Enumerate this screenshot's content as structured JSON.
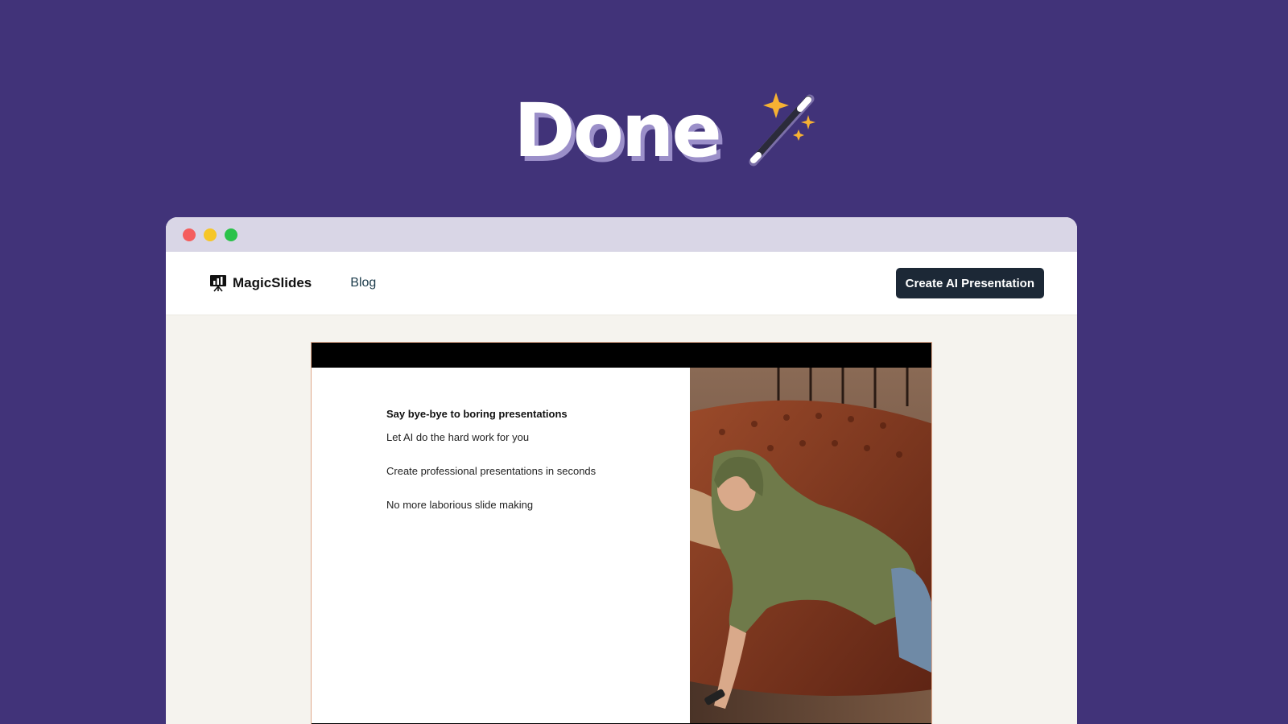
{
  "hero": {
    "title": "Done",
    "icon": "magic-wand-icon",
    "title_shadow_color": "#9b8fc9",
    "sparkle_color": "#f6b133"
  },
  "browser": {
    "controls": [
      "close",
      "minimize",
      "maximize"
    ],
    "control_colors": {
      "close": "#f45d5d",
      "minimize": "#f6c627",
      "maximize": "#2ac24a"
    }
  },
  "nav": {
    "brand_icon": "presentation-board-icon",
    "brand_name": "MagicSlides",
    "blog_label": "Blog",
    "cta_label": "Create AI Presentation"
  },
  "slide": {
    "heading": "Say bye-bye to boring presentations",
    "bullets": [
      "Let AI do the hard work for you",
      "Create professional presentations in seconds",
      "No more laborious slide making"
    ],
    "image": "person-sleeping-on-leather-sofa"
  },
  "colors": {
    "background": "#413379",
    "cta_background": "#1c2836",
    "content_background": "#f5f3ee"
  }
}
